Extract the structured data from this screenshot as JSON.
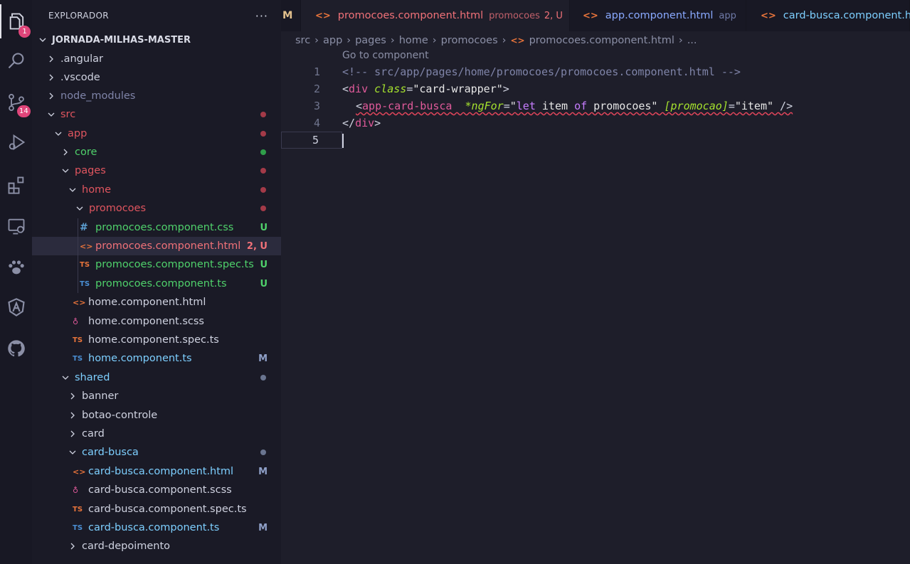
{
  "activity_bar": {
    "explorer_badge": "1",
    "source_control_badge": "14",
    "icons": [
      "files-icon",
      "search-icon",
      "source-control-icon",
      "run-debug-icon",
      "extensions-icon",
      "remote-explorer-icon",
      "paw-icon",
      "angular-icon",
      "github-icon"
    ]
  },
  "sidebar": {
    "title": "EXPLORADOR",
    "more": "···",
    "root": "JORNADA-MILHAS-MASTER",
    "items": [
      {
        "label": ".angular",
        "badge": ""
      },
      {
        "label": ".vscode",
        "badge": ""
      },
      {
        "label": "node_modules",
        "badge": ""
      },
      {
        "label": "src",
        "badge": ""
      },
      {
        "label": "app",
        "badge": ""
      },
      {
        "label": "core",
        "badge": ""
      },
      {
        "label": "pages",
        "badge": ""
      },
      {
        "label": "home",
        "badge": ""
      },
      {
        "label": "promocoes",
        "badge": ""
      },
      {
        "label": "promocoes.component.css",
        "icon": "#",
        "badge": "U"
      },
      {
        "label": "promocoes.component.html",
        "icon": "<>",
        "badge": "2, U"
      },
      {
        "label": "promocoes.component.spec.ts",
        "icon": "TS",
        "badge": "U"
      },
      {
        "label": "promocoes.component.ts",
        "icon": "TS",
        "badge": "U"
      },
      {
        "label": "home.component.html",
        "icon": "<>",
        "badge": ""
      },
      {
        "label": "home.component.scss",
        "icon": "scss",
        "badge": ""
      },
      {
        "label": "home.component.spec.ts",
        "icon": "TS",
        "badge": ""
      },
      {
        "label": "home.component.ts",
        "icon": "TS",
        "badge": "M"
      },
      {
        "label": "shared",
        "badge": ""
      },
      {
        "label": "banner",
        "badge": ""
      },
      {
        "label": "botao-controle",
        "badge": ""
      },
      {
        "label": "card",
        "badge": ""
      },
      {
        "label": "card-busca",
        "badge": ""
      },
      {
        "label": "card-busca.component.html",
        "icon": "<>",
        "badge": "M"
      },
      {
        "label": "card-busca.component.scss",
        "icon": "scss",
        "badge": ""
      },
      {
        "label": "card-busca.component.spec.ts",
        "icon": "TS",
        "badge": ""
      },
      {
        "label": "card-busca.component.ts",
        "icon": "TS",
        "badge": "M"
      },
      {
        "label": "card-depoimento",
        "badge": ""
      }
    ]
  },
  "tabs": [
    {
      "label": "M",
      "desc": ""
    },
    {
      "label": "promocoes.component.html",
      "desc": "promocoes",
      "status": "2, U",
      "icon": "<>"
    },
    {
      "label": "app.component.html",
      "desc": "app",
      "icon": "<>"
    },
    {
      "label": "card-busca.component.ht",
      "desc": "",
      "icon": "<>"
    }
  ],
  "breadcrumb": [
    "src",
    "app",
    "pages",
    "home",
    "promocoes",
    "promocoes.component.html",
    "..."
  ],
  "editor": {
    "codelens": "Go to component",
    "line_numbers": [
      "1",
      "2",
      "3",
      "4",
      "5"
    ],
    "line1": "<!-- src/app/pages/home/promocoes/promocoes.component.html -->",
    "l2": {
      "open": "<",
      "tag": "div",
      "attr": "class",
      "eq": "=",
      "val": "\"card-wrapper\"",
      "close": ">"
    },
    "l3": {
      "open": "<",
      "tag": "app-card-busca",
      "attr": "*ngFor",
      "eq": "=",
      "q1": "\"",
      "kw1": "let",
      "mid1": " item ",
      "kw2": "of",
      "mid2": " promocoes\"",
      "bind": "[promocao]",
      "eq2": "=",
      "val2": "\"item\"",
      "close": " />"
    },
    "l4": {
      "open": "</",
      "tag": "div",
      "close": ">"
    }
  }
}
